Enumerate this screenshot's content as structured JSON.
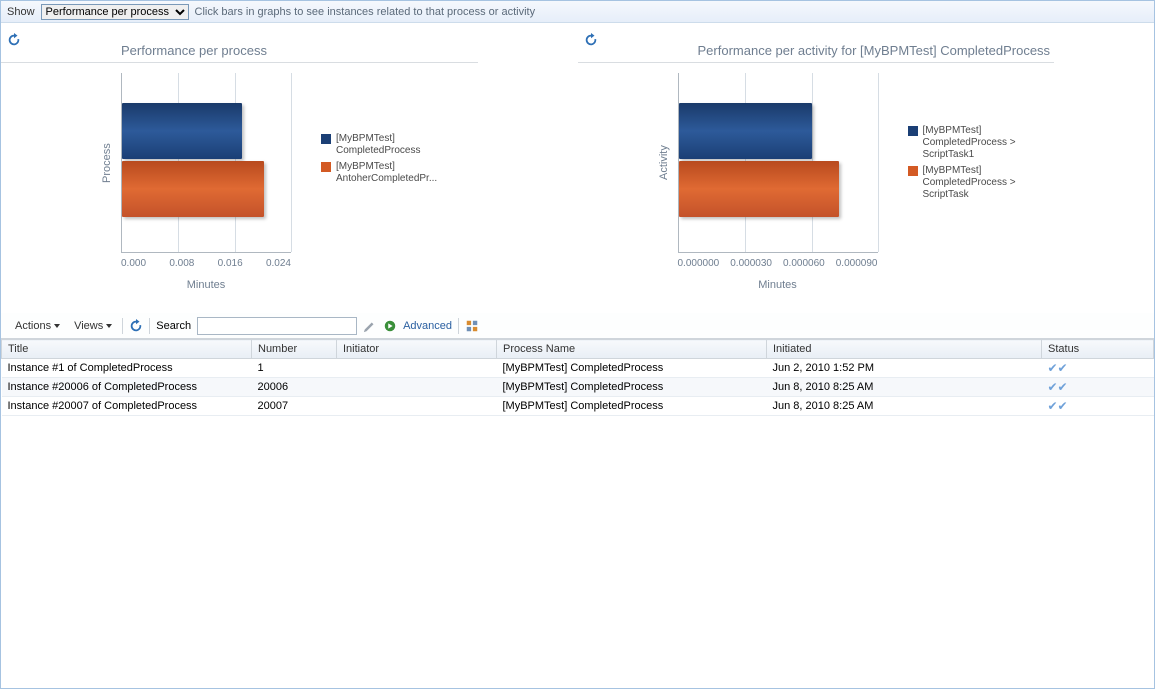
{
  "top": {
    "show_label": "Show",
    "select_value": "Performance per process",
    "hint": "Click bars in graphs to see instances related to that process or activity"
  },
  "chart_data": [
    {
      "type": "bar",
      "title": "Performance per process",
      "ylabel": "Process",
      "xlabel": "Minutes",
      "xlim": [
        0,
        0.024
      ],
      "xticks": [
        "0.000",
        "0.008",
        "0.016",
        "0.024"
      ],
      "series": [
        {
          "name": "[MyBPMTest] CompletedProcess",
          "value": 0.017,
          "color": "blue"
        },
        {
          "name": "[MyBPMTest] AntoherCompletedPr...",
          "value": 0.02,
          "color": "orange"
        }
      ]
    },
    {
      "type": "bar",
      "title": "Performance per activity for [MyBPMTest] CompletedProcess",
      "ylabel": "Activity",
      "xlabel": "Minutes",
      "xlim": [
        0,
        9e-05
      ],
      "xticks": [
        "0.000000",
        "0.000030",
        "0.000060",
        "0.000090"
      ],
      "series": [
        {
          "name": "[MyBPMTest] CompletedProcess > ScriptTask1",
          "value": 6e-05,
          "color": "blue"
        },
        {
          "name": "[MyBPMTest] CompletedProcess > ScriptTask",
          "value": 7.2e-05,
          "color": "orange"
        }
      ]
    }
  ],
  "midbar": {
    "actions_label": "Actions",
    "views_label": "Views",
    "search_label": "Search",
    "search_value": "",
    "advanced_label": "Advanced"
  },
  "table": {
    "columns": [
      "Title",
      "Number",
      "Initiator",
      "Process Name",
      "Initiated",
      "Status"
    ],
    "rows": [
      {
        "title": "Instance #1 of CompletedProcess",
        "number": "1",
        "initiator": "",
        "process": "[MyBPMTest] CompletedProcess",
        "initiated": "Jun 2, 2010 1:52 PM",
        "status": "ok"
      },
      {
        "title": "Instance #20006 of CompletedProcess",
        "number": "20006",
        "initiator": "",
        "process": "[MyBPMTest] CompletedProcess",
        "initiated": "Jun 8, 2010 8:25 AM",
        "status": "ok"
      },
      {
        "title": "Instance #20007 of CompletedProcess",
        "number": "20007",
        "initiator": "",
        "process": "[MyBPMTest] CompletedProcess",
        "initiated": "Jun 8, 2010 8:25 AM",
        "status": "ok"
      }
    ]
  }
}
